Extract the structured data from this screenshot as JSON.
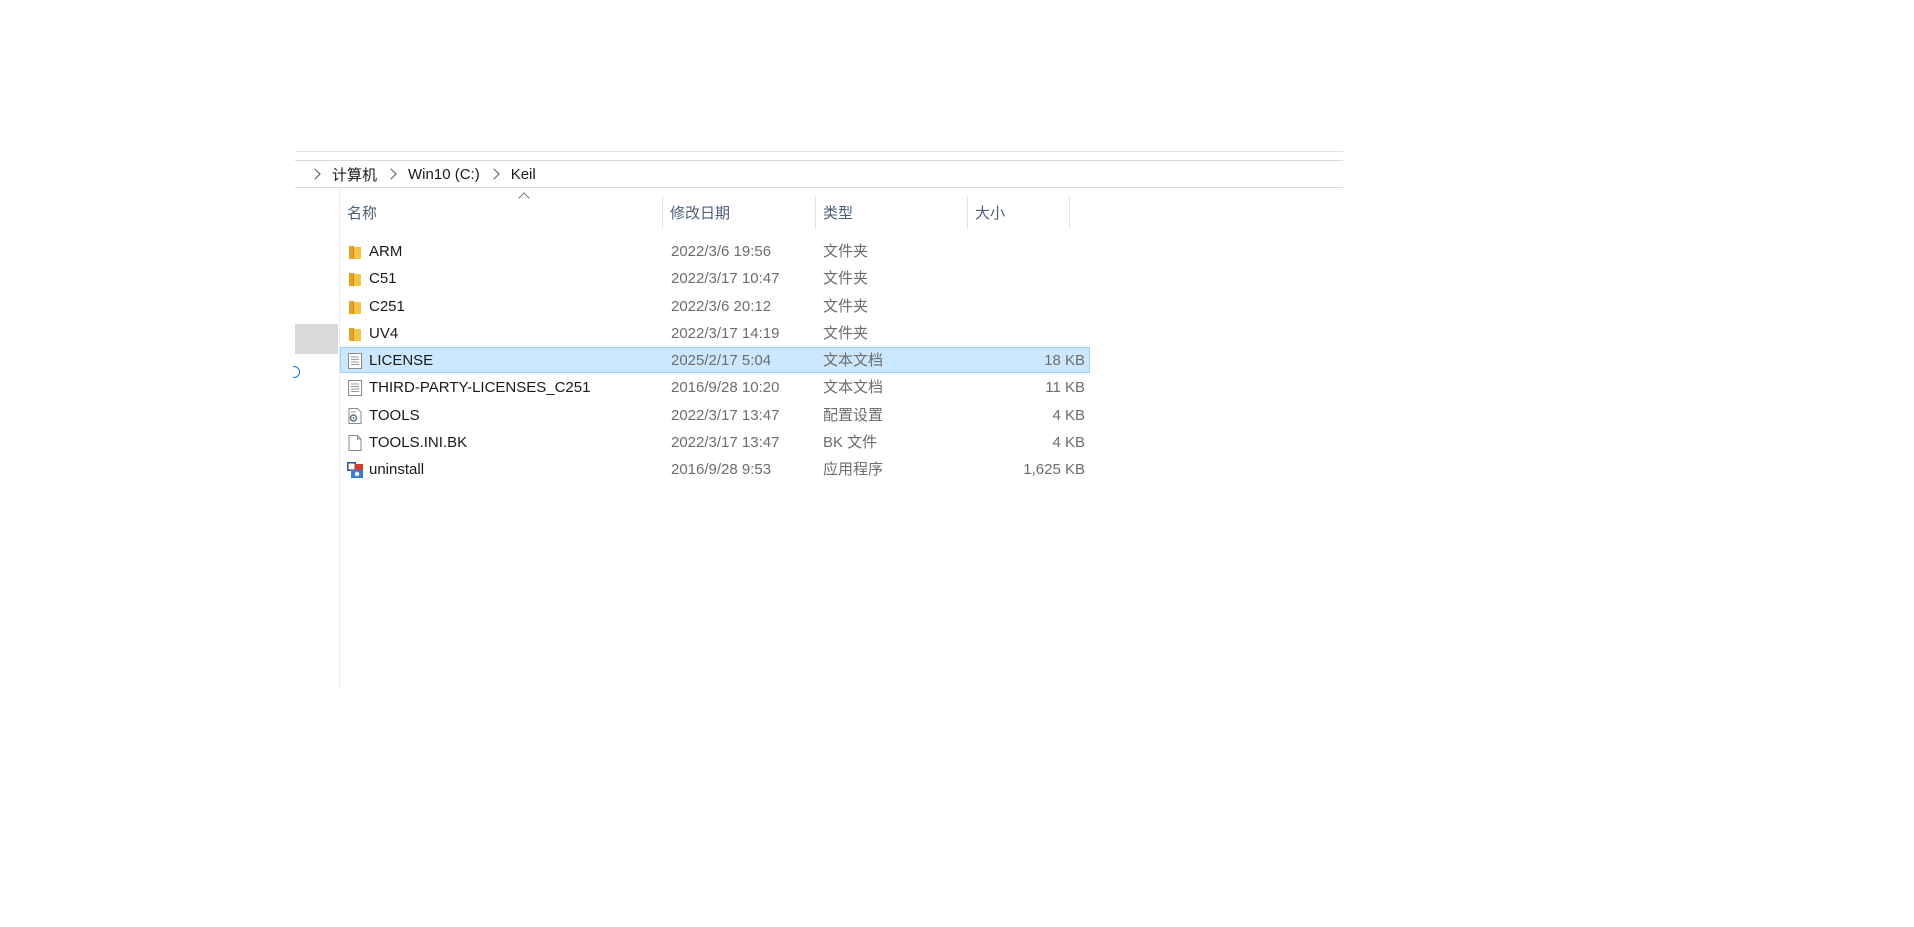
{
  "breadcrumb": [
    "计算机",
    "Win10 (C:)",
    "Keil"
  ],
  "columns": {
    "name": "名称",
    "modified": "修改日期",
    "type": "类型",
    "size": "大小"
  },
  "files": [
    {
      "name": "ARM",
      "modified": "2022/3/6 19:56",
      "type": "文件夹",
      "size": "",
      "icon": "folder-icon"
    },
    {
      "name": "C51",
      "modified": "2022/3/17 10:47",
      "type": "文件夹",
      "size": "",
      "icon": "folder-icon"
    },
    {
      "name": "C251",
      "modified": "2022/3/6 20:12",
      "type": "文件夹",
      "size": "",
      "icon": "folder-icon"
    },
    {
      "name": "UV4",
      "modified": "2022/3/17 14:19",
      "type": "文件夹",
      "size": "",
      "icon": "folder-icon"
    },
    {
      "name": "LICENSE",
      "modified": "2025/2/17 5:04",
      "type": "文本文档",
      "size": "18 KB",
      "icon": "text-file-icon",
      "selected": true
    },
    {
      "name": "THIRD-PARTY-LICENSES_C251",
      "modified": "2016/9/28 10:20",
      "type": "文本文档",
      "size": "11 KB",
      "icon": "text-file-icon"
    },
    {
      "name": "TOOLS",
      "modified": "2022/3/17 13:47",
      "type": "配置设置",
      "size": "4 KB",
      "icon": "settings-file-icon"
    },
    {
      "name": "TOOLS.INI.BK",
      "modified": "2022/3/17 13:47",
      "type": "BK 文件",
      "size": "4 KB",
      "icon": "blank-file-icon"
    },
    {
      "name": "uninstall",
      "modified": "2016/9/28 9:53",
      "type": "应用程序",
      "size": "1,625 KB",
      "icon": "application-icon"
    }
  ],
  "colors": {
    "selection_fill": "#cce8ff",
    "selection_border": "#99d1ff",
    "folder": "#f6c344",
    "header_text": "#4c607a"
  }
}
